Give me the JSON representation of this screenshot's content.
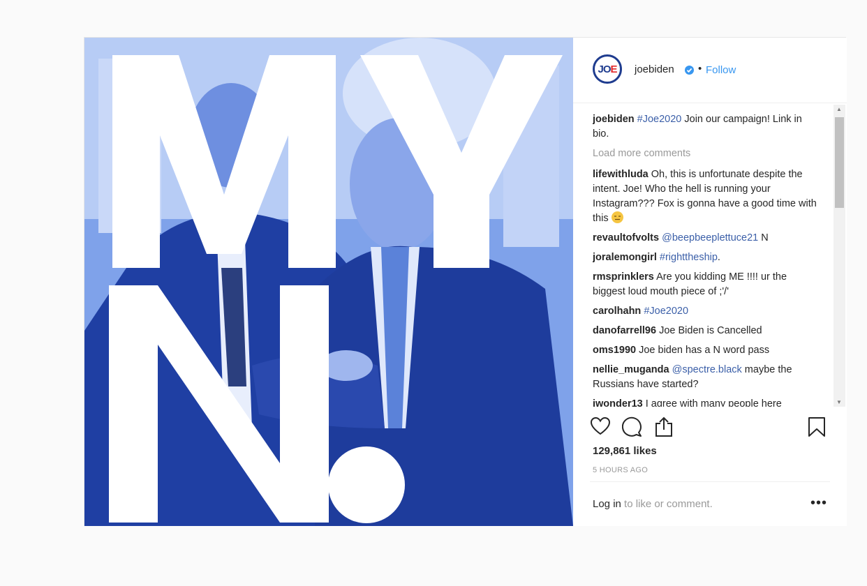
{
  "post": {
    "username": "joebiden",
    "avatar_text_a": "JO",
    "avatar_text_b": "E",
    "follow_separator": "•",
    "follow_label": "Follow",
    "colors": {
      "link": "#3897f0",
      "mention": "#3b5fa8",
      "brand_blue": "#1f3c8f",
      "brand_red": "#e2282a"
    }
  },
  "media": {
    "letters": [
      "M",
      "Y",
      "N"
    ],
    "icon": "photo-two-men-blue-tint"
  },
  "caption": {
    "user": "joebiden",
    "hashtag": "#Joe2020",
    "text": " Join our campaign! Link in bio."
  },
  "load_more": "Load more comments",
  "comments": [
    {
      "user": "lifewithluda",
      "pre": " Oh, this is unfortunate despite the intent. Joe! Who the hell is running your Instagram??? Fox is gonna have a good time with this ",
      "tag": "",
      "post": ""
    },
    {
      "user": "revaultofvolts",
      "pre": " ",
      "tag": "@beepbeeplettuce21",
      "post": " N"
    },
    {
      "user": "joralemongirl",
      "pre": " ",
      "tag": "#righttheship",
      "post": "."
    },
    {
      "user": "rmsprinklers",
      "pre": " Are you kidding ME !!!! ur the biggest loud mouth piece of ;'/'",
      "tag": "",
      "post": ""
    },
    {
      "user": "carolhahn",
      "pre": " ",
      "tag": "#Joe2020",
      "post": ""
    },
    {
      "user": "danofarrell96",
      "pre": " Joe Biden is Cancelled",
      "tag": "",
      "post": ""
    },
    {
      "user": "oms1990",
      "pre": " Joe biden has a N word pass",
      "tag": "",
      "post": ""
    },
    {
      "user": "nellie_muganda",
      "pre": " ",
      "tag": "@spectre.black",
      "post": " maybe the Russians have started?"
    },
    {
      "user": "iwonder13",
      "pre": " I agree with many people here",
      "tag": "",
      "post": ""
    }
  ],
  "actions": {
    "icons": [
      "heart-icon",
      "comment-icon",
      "share-icon",
      "bookmark-icon"
    ]
  },
  "likes": "129,861 likes",
  "time": "5 HOURS AGO",
  "footer": {
    "login_link": "Log in",
    "login_text": " to like or comment.",
    "more": "•••"
  }
}
